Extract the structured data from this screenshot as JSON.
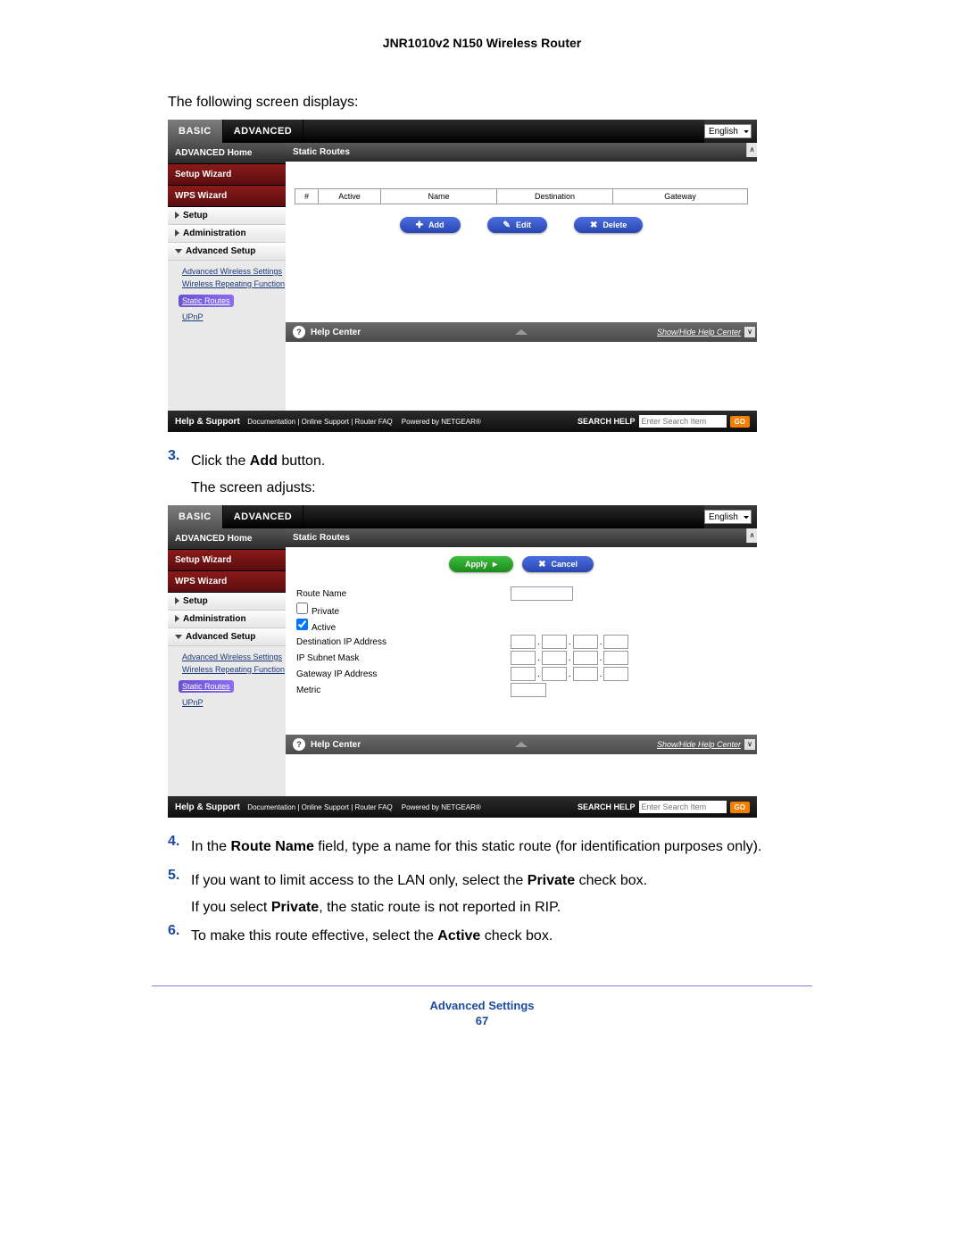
{
  "header": {
    "title": "JNR1010v2 N150 Wireless Router"
  },
  "intro": "The following screen displays:",
  "step3": {
    "num": "3.",
    "text_pre": "Click the ",
    "text_bold": "Add",
    "text_post": " button.",
    "sub": "The screen adjusts:"
  },
  "step4": {
    "num": "4.",
    "pre": "In the ",
    "b1": "Route Name",
    "post": " field, type a name for this static route (for identification purposes only)."
  },
  "step5": {
    "num": "5.",
    "pre": "If you want to limit access to the LAN only, select the ",
    "b1": "Private",
    "post": " check box.",
    "sub_pre": "If you select ",
    "sub_b": "Private",
    "sub_post": ", the static route is not reported in RIP."
  },
  "step6": {
    "num": "6.",
    "pre": "To make this route effective, select the ",
    "b1": "Active",
    "post": " check box."
  },
  "footer": {
    "title": "Advanced Settings",
    "page": "67"
  },
  "ui": {
    "tabs": {
      "basic": "BASIC",
      "advanced": "ADVANCED"
    },
    "language": "English",
    "sidebar": {
      "advanced_home": "ADVANCED Home",
      "setup_wizard": "Setup Wizard",
      "wps_wizard": "WPS Wizard",
      "setup": "Setup",
      "administration": "Administration",
      "advanced_setup": "Advanced Setup",
      "sub": {
        "aws": "Advanced Wireless Settings",
        "wrf": "Wireless Repeating Function",
        "static_routes": "Static Routes",
        "upnp": "UPnP"
      }
    },
    "panel_title": "Static Routes",
    "table": {
      "num": "#",
      "active": "Active",
      "name": "Name",
      "destination": "Destination",
      "gateway": "Gateway"
    },
    "buttons": {
      "add": "Add",
      "edit": "Edit",
      "delete": "Delete",
      "apply": "Apply",
      "cancel": "Cancel"
    },
    "help_center": "Help Center",
    "show_hide": "Show/Hide Help Center",
    "support": {
      "label": "Help & Support",
      "links": "Documentation | Online Support | Router FAQ",
      "powered": "Powered by NETGEAR®",
      "search_label": "SEARCH HELP",
      "placeholder": "Enter Search Item",
      "go": "GO"
    },
    "form": {
      "route_name": "Route Name",
      "private": "Private",
      "active": "Active",
      "dest_ip": "Destination IP Address",
      "subnet": "IP Subnet Mask",
      "gw_ip": "Gateway IP Address",
      "metric": "Metric"
    }
  }
}
